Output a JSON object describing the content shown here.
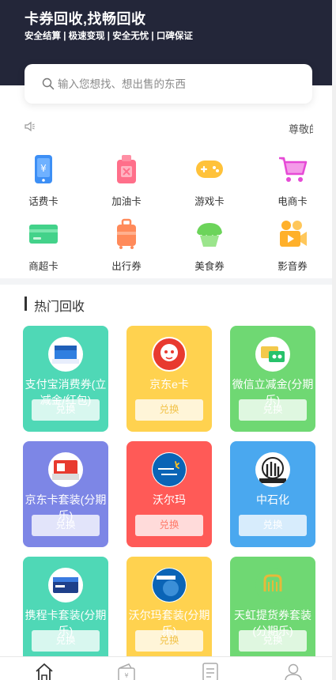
{
  "header": {
    "title": "卡券回收,找畅回收",
    "subtitle": "安全结算 | 极速变现 | 安全无忧 | 口碑保证"
  },
  "search": {
    "placeholder": "输入您想找、想出售的东西"
  },
  "notice": {
    "text": "尊敬的"
  },
  "categories": [
    {
      "label": "话费卡",
      "icon": "phone-card-icon",
      "color": "#3d8ff5"
    },
    {
      "label": "加油卡",
      "icon": "fuel-can-icon",
      "color": "#ff6f8a"
    },
    {
      "label": "游戏卡",
      "icon": "gamepad-icon",
      "color": "#ffc23a"
    },
    {
      "label": "电商卡",
      "icon": "shopping-cart-icon",
      "color": "#e64ad6"
    },
    {
      "label": "商超卡",
      "icon": "supermarket-card-icon",
      "color": "#43d28a"
    },
    {
      "label": "出行券",
      "icon": "luggage-icon",
      "color": "#ff8a5a"
    },
    {
      "label": "美食券",
      "icon": "food-icon",
      "color": "#6cd45a"
    },
    {
      "label": "影音券",
      "icon": "video-camera-icon",
      "color": "#ffb02a"
    }
  ],
  "hot": {
    "title": "热门回收",
    "cards": [
      {
        "name": "支付宝消费券(立减金/红包)",
        "button": "兑换",
        "bg": "#4fd8b6",
        "logo": "alipay-voucher-icon"
      },
      {
        "name": "京东e卡",
        "button": "兑换",
        "bg": "#ffd24f",
        "logo": "jd-dog-icon"
      },
      {
        "name": "微信立减金(分期乐)",
        "button": "兑换",
        "bg": "#6fd873",
        "logo": "wechat-voucher-icon"
      },
      {
        "name": "京东卡套装(分期乐)",
        "button": "兑换",
        "bg": "#7d86e6",
        "logo": "jd-card-set-icon"
      },
      {
        "name": "沃尔玛",
        "button": "兑换",
        "bg": "#ff5a57",
        "logo": "walmart-icon"
      },
      {
        "name": "中石化",
        "button": "兑换",
        "bg": "#4aa8ef",
        "logo": "sinopec-icon"
      },
      {
        "name": "携程卡套装(分期乐)",
        "button": "兑换",
        "bg": "#4fd8b6",
        "logo": "ctrip-card-icon"
      },
      {
        "name": "沃尔玛套装(分期乐)",
        "button": "兑换",
        "bg": "#ffd24f",
        "logo": "walmart-set-icon"
      },
      {
        "name": "天虹提货券套装(分期乐)",
        "button": "兑换",
        "bg": "#6fd873",
        "logo": "tianhong-icon"
      }
    ]
  },
  "tabbar": {
    "items": [
      {
        "icon": "home-icon"
      },
      {
        "icon": "wallet-icon"
      },
      {
        "icon": "orders-icon"
      },
      {
        "icon": "profile-icon"
      }
    ]
  }
}
